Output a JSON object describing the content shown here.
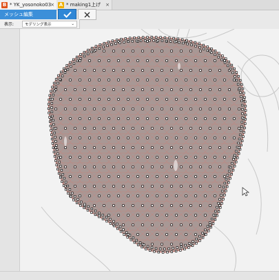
{
  "tabs": [
    {
      "icon_letter": "B",
      "label": "* YK_yosonoko03",
      "close": "×"
    },
    {
      "icon_letter": "A",
      "label": "* making1上げ",
      "close": "×"
    }
  ],
  "panel": {
    "title": "メッシュ編集",
    "ok_icon": "checkmark-icon",
    "cancel_icon": "x-icon",
    "display_label": "表示:",
    "display_value": "モデリング表示",
    "colors": {
      "accent": "#3c8fd9",
      "mesh_fill": "#8a7470",
      "mesh_line": "#d9746a"
    }
  }
}
